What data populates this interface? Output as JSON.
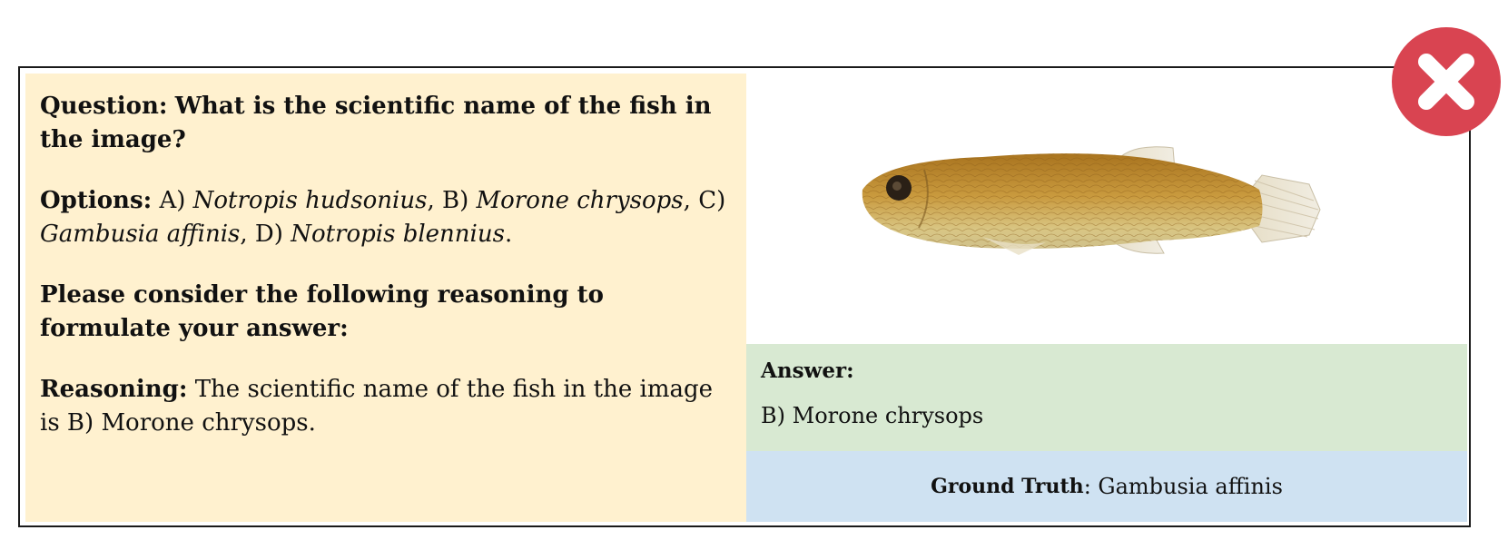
{
  "question": {
    "label": "Question:",
    "text": "What is the scientific name of the fish in the image?"
  },
  "options": {
    "label": "Options:",
    "items": [
      {
        "letter": "A)",
        "name": "Notropis hudsonius",
        "sep": ","
      },
      {
        "letter": "B)",
        "name": "Morone chrysops",
        "sep": ","
      },
      {
        "letter": "C)",
        "name": "Gambusia affinis",
        "sep": ","
      },
      {
        "letter": "D)",
        "name": "Notropis blennius",
        "sep": "."
      }
    ]
  },
  "prompt": {
    "text": "Please consider the following reasoning to formulate your answer:"
  },
  "reasoning": {
    "label": "Reasoning:",
    "text": "The scientific name of the fish in the image is B) Morone chrysops."
  },
  "answer": {
    "label": "Answer:",
    "text": "B) Morone chrysops"
  },
  "ground_truth": {
    "label": "Ground Truth",
    "colon": ":",
    "text": "Gambusia affinis"
  },
  "status": {
    "icon": "close-icon",
    "color": "#d94451"
  },
  "colors": {
    "question_panel": "#fff1cf",
    "answer_panel": "#d8e9d2",
    "ground_truth_panel": "#cfe2f2"
  }
}
